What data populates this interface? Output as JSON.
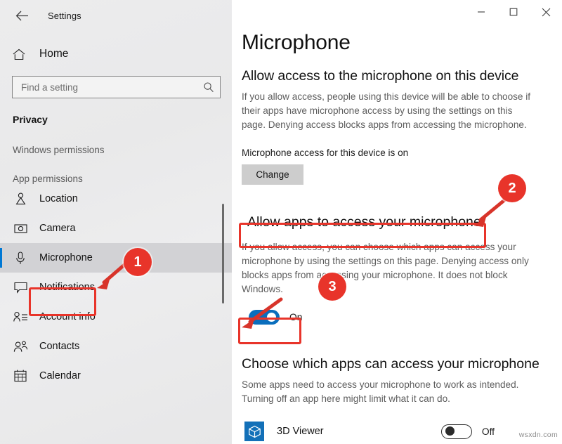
{
  "window": {
    "title": "Settings",
    "back_icon": "back-arrow-icon",
    "controls": {
      "minimize": "–",
      "maximize": "☐",
      "close": "✕"
    }
  },
  "sidebar": {
    "home_label": "Home",
    "home_icon": "home-icon",
    "search": {
      "placeholder": "Find a setting",
      "value": "",
      "icon": "search-icon"
    },
    "category": "Privacy",
    "groups": [
      {
        "header": "Windows permissions",
        "items": []
      },
      {
        "header": "App permissions",
        "items": [
          {
            "label": "Location",
            "icon": "location-pin-icon",
            "selected": false
          },
          {
            "label": "Camera",
            "icon": "camera-icon",
            "selected": false
          },
          {
            "label": "Microphone",
            "icon": "microphone-icon",
            "selected": true
          },
          {
            "label": "Notifications",
            "icon": "notification-bubble-icon",
            "selected": false
          },
          {
            "label": "Account info",
            "icon": "account-info-icon",
            "selected": false
          },
          {
            "label": "Contacts",
            "icon": "contacts-icon",
            "selected": false
          },
          {
            "label": "Calendar",
            "icon": "calendar-icon",
            "selected": false
          }
        ]
      }
    ]
  },
  "main": {
    "page_title": "Microphone",
    "device_section": {
      "heading": "Allow access to the microphone on this device",
      "description": "If you allow access, people using this device will be able to choose if their apps have microphone access by using the settings on this page. Denying access blocks apps from accessing the microphone.",
      "status": "Microphone access for this device is on",
      "change_button": "Change"
    },
    "apps_section": {
      "heading": "Allow apps to access your microphone",
      "description": "If you allow access, you can choose which apps can access your microphone by using the settings on this page. Denying access only blocks apps from accessing your microphone. It does not block Windows.",
      "toggle_state": "On"
    },
    "choose_section": {
      "heading": "Choose which apps can access your microphone",
      "description": "Some apps need to access your microphone to work as intended. Turning off an app here might limit what it can do.",
      "apps": [
        {
          "name": "3D Viewer",
          "icon": "3d-viewer-icon",
          "toggle_state": "Off"
        }
      ]
    }
  },
  "annotations": {
    "markers": [
      {
        "id": "1",
        "label": "1"
      },
      {
        "id": "2",
        "label": "2"
      },
      {
        "id": "3",
        "label": "3"
      }
    ],
    "highlight_color": "#e8342a"
  },
  "watermark": "wsxdn.com",
  "colors": {
    "accent": "#0078d4",
    "toggle_on": "#0a6ebd",
    "annotation_red": "#e8342a",
    "app_tile": "#1370b8"
  }
}
